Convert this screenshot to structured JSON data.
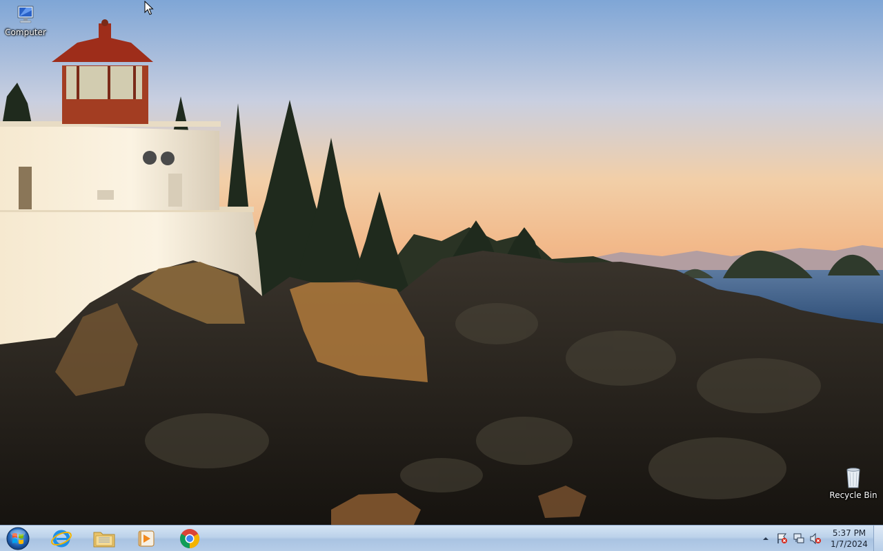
{
  "desktop": {
    "icons": [
      {
        "label": "Computer",
        "icon": "computer-icon"
      },
      {
        "label": "Recycle Bin",
        "icon": "recycle-bin-icon"
      }
    ]
  },
  "taskbar": {
    "start_icon": "windows-start-orb",
    "pinned": [
      {
        "name": "Internet Explorer",
        "icon": "internet-explorer-icon"
      },
      {
        "name": "Windows Explorer",
        "icon": "folder-icon"
      },
      {
        "name": "Windows Media Player",
        "icon": "media-player-icon"
      },
      {
        "name": "Google Chrome",
        "icon": "chrome-icon"
      }
    ],
    "tray": {
      "icons": [
        "show-hidden-icons-arrow",
        "action-center-flag-icon",
        "network-icon",
        "volume-muted-icon"
      ],
      "time": "5:37 PM",
      "date": "1/7/2024"
    }
  },
  "colors": {
    "taskbar": "#bcd2ea",
    "sky_top": "#7fa6d6",
    "sky_bottom": "#f2b98a",
    "sea": "#3d5e85"
  }
}
